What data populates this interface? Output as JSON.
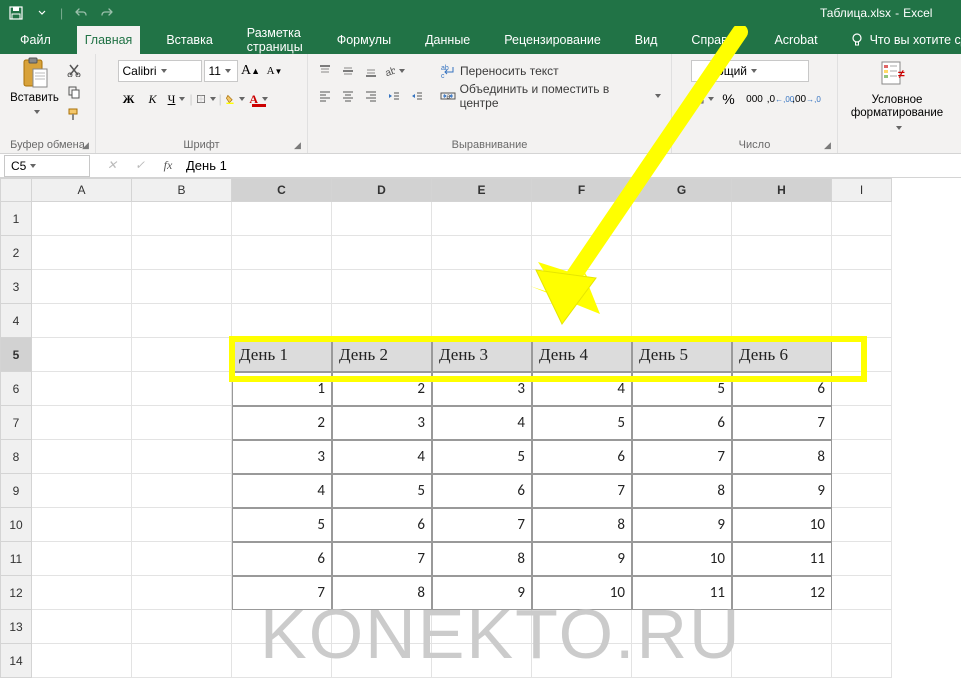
{
  "colors": {
    "brand": "#217346",
    "accent": "#ffff00"
  },
  "window": {
    "doc_name": "Таблица.xlsx",
    "app_name": "Excel"
  },
  "qat": {
    "save": "save-icon",
    "undo": "undo-icon",
    "redo": "redo-icon"
  },
  "tabs": {
    "file": "Файл",
    "home": "Главная",
    "insert": "Вставка",
    "pagelayout": "Разметка страницы",
    "formulas": "Формулы",
    "data": "Данные",
    "review": "Рецензирование",
    "view": "Вид",
    "help": "Справка",
    "acrobat": "Acrobat",
    "tell_me": "Что вы хотите сделать?"
  },
  "ribbon": {
    "clipboard": {
      "paste": "Вставить",
      "group": "Буфер обмена"
    },
    "font": {
      "name": "Calibri",
      "size": "11",
      "group": "Шрифт",
      "bold": "Ж",
      "italic": "К",
      "underline": "Ч"
    },
    "alignment": {
      "group": "Выравнивание",
      "wrap": "Переносить текст",
      "merge": "Объединить и поместить в центре"
    },
    "number": {
      "group": "Число",
      "format": "Общий",
      "percent": "%",
      "comma": "000",
      "inc": ",0",
      "dec": ",00"
    },
    "styles": {
      "cond": "Условное форматирование"
    }
  },
  "formula_bar": {
    "name_box": "C5",
    "formula_value": "День 1"
  },
  "grid": {
    "columns": [
      "A",
      "B",
      "C",
      "D",
      "E",
      "F",
      "G",
      "H",
      "I"
    ],
    "rows": [
      "1",
      "2",
      "3",
      "4",
      "5",
      "6",
      "7",
      "8",
      "9",
      "10",
      "11",
      "12",
      "13",
      "14"
    ],
    "selected_cols": [
      "C",
      "D",
      "E",
      "F",
      "G",
      "H"
    ],
    "selected_row": "5",
    "headers": [
      "День 1",
      "День 2",
      "День 3",
      "День 4",
      "День 5",
      "День 6"
    ],
    "data": [
      [
        1,
        2,
        3,
        4,
        5,
        6
      ],
      [
        2,
        3,
        4,
        5,
        6,
        7
      ],
      [
        3,
        4,
        5,
        6,
        7,
        8
      ],
      [
        4,
        5,
        6,
        7,
        8,
        9
      ],
      [
        5,
        6,
        7,
        8,
        9,
        10
      ],
      [
        6,
        7,
        8,
        9,
        10,
        11
      ],
      [
        7,
        8,
        9,
        10,
        11,
        12
      ]
    ]
  },
  "watermark": "KONEKTO.RU",
  "chart_data": {
    "type": "table",
    "title": "Таблица.xlsx",
    "columns": [
      "День 1",
      "День 2",
      "День 3",
      "День 4",
      "День 5",
      "День 6"
    ],
    "rows": [
      [
        1,
        2,
        3,
        4,
        5,
        6
      ],
      [
        2,
        3,
        4,
        5,
        6,
        7
      ],
      [
        3,
        4,
        5,
        6,
        7,
        8
      ],
      [
        4,
        5,
        6,
        7,
        8,
        9
      ],
      [
        5,
        6,
        7,
        8,
        9,
        10
      ],
      [
        6,
        7,
        8,
        9,
        10,
        11
      ],
      [
        7,
        8,
        9,
        10,
        11,
        12
      ]
    ]
  }
}
